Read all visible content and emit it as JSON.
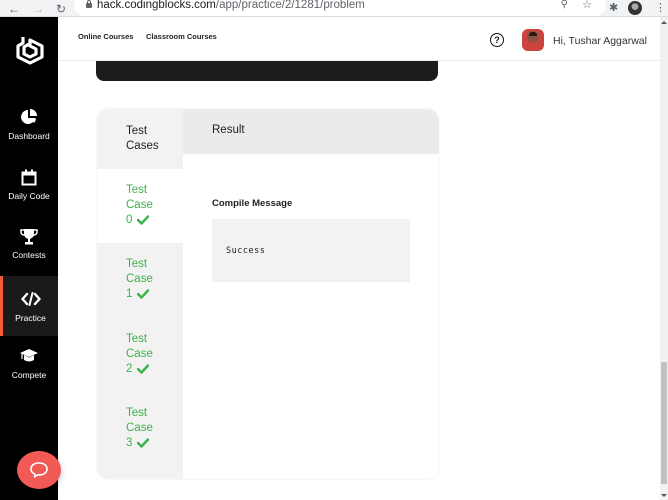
{
  "browser": {
    "url_host": "hack.codingblocks.com",
    "url_path": "/app/practice/2/1281/problem",
    "icons": [
      "back-icon",
      "forward-icon",
      "reload-icon",
      "lock-icon",
      "zoom-icon",
      "star-icon",
      "extensions-icon",
      "profile-icon",
      "menu-icon"
    ]
  },
  "sidebar": {
    "logo": "coding-blocks-logo",
    "items": [
      {
        "label": "Dashboard",
        "icon": "pie-chart-icon",
        "active": false
      },
      {
        "label": "Daily Code",
        "icon": "calendar-icon",
        "active": false
      },
      {
        "label": "Contests",
        "icon": "trophy-icon",
        "active": false
      },
      {
        "label": "Practice",
        "icon": "code-icon",
        "active": true
      },
      {
        "label": "Compete",
        "icon": "graduation-cap-icon",
        "active": false
      }
    ],
    "active_color": "#f55a3c"
  },
  "header": {
    "links": [
      "Online Courses",
      "Classroom Courses"
    ],
    "help_symbol": "?",
    "greeting": "Hi, Tushar Aggarwal"
  },
  "results": {
    "test_cases_header": "Test Cases",
    "result_header": "Result",
    "test_cases": [
      {
        "label": "Test Case",
        "number": "0",
        "status": "passed",
        "active": true
      },
      {
        "label": "Test Case",
        "number": "1",
        "status": "passed",
        "active": false
      },
      {
        "label": "Test Case",
        "number": "2",
        "status": "passed",
        "active": false
      },
      {
        "label": "Test Case",
        "number": "3",
        "status": "passed",
        "active": false
      }
    ],
    "compile_message_label": "Compile Message",
    "compile_message": "Success",
    "pass_color": "#3cb34a"
  },
  "chat": {
    "icon": "chat-bubble-icon",
    "color": "#f15a55"
  }
}
